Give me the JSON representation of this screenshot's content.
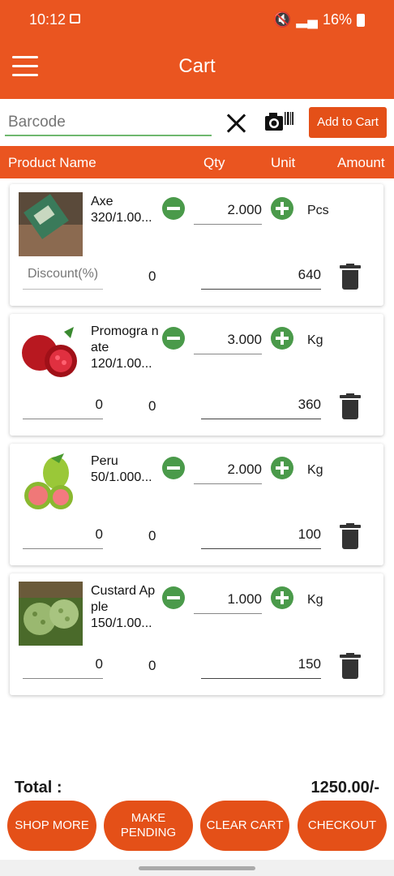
{
  "status_bar": {
    "time": "10:12",
    "battery": "16%"
  },
  "app_bar": {
    "title": "Cart"
  },
  "barcode": {
    "placeholder": "Barcode",
    "add_to_cart_label": "Add to Cart"
  },
  "table_header": {
    "product_name": "Product Name",
    "qty": "Qty",
    "unit": "Unit",
    "amount": "Amount"
  },
  "items": [
    {
      "name": "Axe",
      "rate": "320/1.00...",
      "qty": "2.000",
      "unit": "Pcs",
      "discount_placeholder": "Discount(%)",
      "discount_amount": "0",
      "amount": "640"
    },
    {
      "name": "Promogra nate",
      "rate": "120/1.00...",
      "qty": "3.000",
      "unit": "Kg",
      "discount": "0",
      "discount_amount": "0",
      "amount": "360"
    },
    {
      "name": "Peru",
      "rate": "50/1.000...",
      "qty": "2.000",
      "unit": "Kg",
      "discount": "0",
      "discount_amount": "0",
      "amount": "100"
    },
    {
      "name": "Custard Apple",
      "rate": "150/1.00...",
      "qty": "1.000",
      "unit": "Kg",
      "discount": "0",
      "discount_amount": "0",
      "amount": "150"
    }
  ],
  "totals": {
    "label": "Total :",
    "value": "1250.00/-"
  },
  "buttons": {
    "shop_more": "SHOP MORE",
    "make_pending": "MAKE PENDING",
    "clear_cart": "CLEAR CART",
    "checkout": "CHECKOUT"
  },
  "colors": {
    "primary": "#ea5520",
    "button": "#e45018",
    "qty_button": "#4a9a4a"
  }
}
